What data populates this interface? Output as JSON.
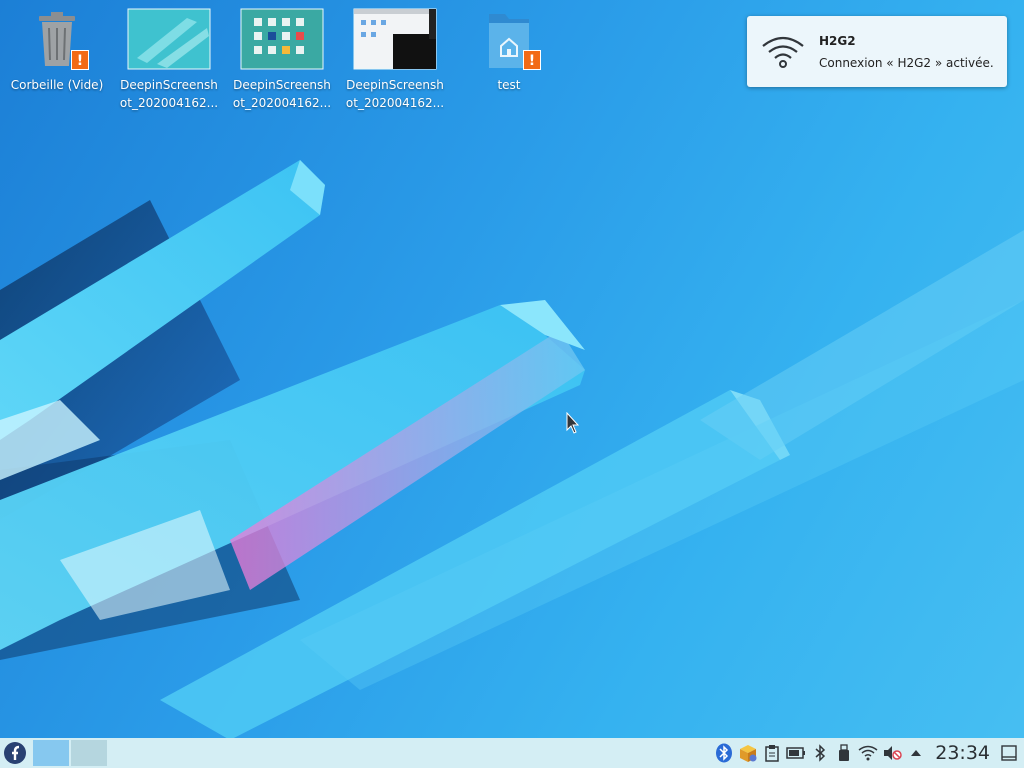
{
  "desktop": {
    "icons": [
      {
        "label": "Corbeille (Vide)",
        "icon": "trash-icon",
        "badge": "!"
      },
      {
        "label": "DeepinScreensh ot_202004162...",
        "icon": "image-thumbnail-icon"
      },
      {
        "label": "DeepinScreensh ot_202004162...",
        "icon": "image-thumbnail-icon"
      },
      {
        "label": "DeepinScreensh ot_202004162...",
        "icon": "image-thumbnail-icon"
      },
      {
        "label": "test",
        "icon": "home-folder-icon",
        "badge": "!"
      }
    ]
  },
  "notification": {
    "title": "H2G2",
    "body": "Connexion « H2G2 » activée.",
    "icon": "wifi-icon"
  },
  "taskbar": {
    "launcher_icon": "fedora-logo-icon",
    "virtual_desktops": [
      "desktop-1",
      "desktop-2"
    ],
    "tray_icons": [
      "bluetooth-app-icon",
      "package-updater-icon",
      "clipboard-icon",
      "battery-icon",
      "bluetooth-icon",
      "usb-device-icon",
      "wifi-icon",
      "volume-muted-icon",
      "expand-tray-arrow-icon"
    ],
    "clock": "23:34",
    "show_desktop_icon": "show-desktop-icon"
  },
  "colors": {
    "wallpaper": "#2a9be8",
    "taskbar": "#d4eef4",
    "badge": "#f26a15",
    "notification_bg": "#ecf6fb"
  }
}
